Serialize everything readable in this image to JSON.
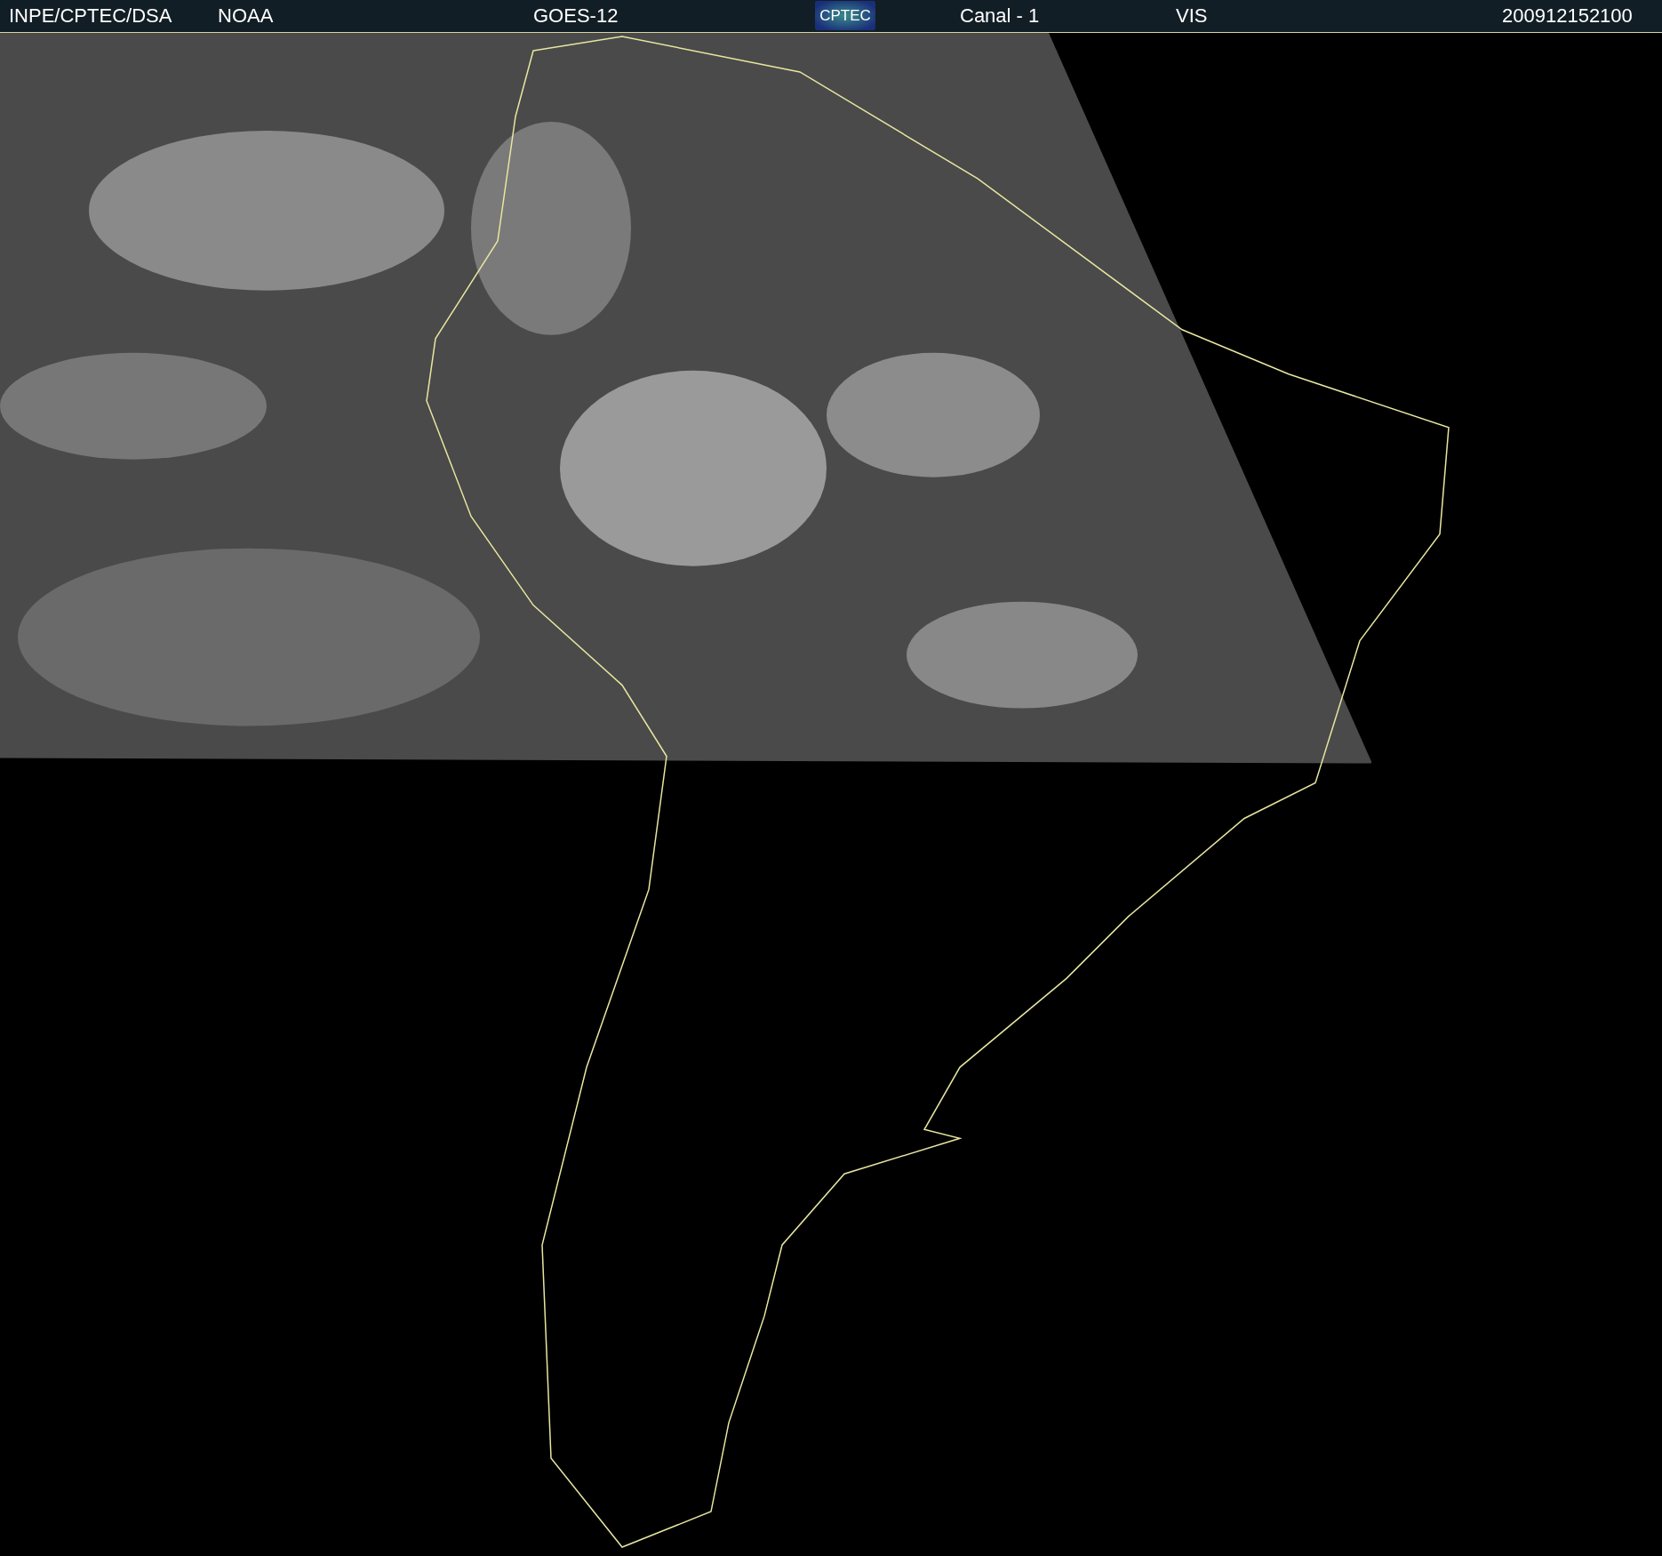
{
  "header": {
    "items": [
      {
        "kind": "text",
        "text": "INPE/CPTEC/DSA"
      },
      {
        "kind": "text",
        "text": "NOAA"
      },
      {
        "kind": "text",
        "text": "GOES-12"
      },
      {
        "kind": "logo",
        "text": "CPTEC"
      },
      {
        "kind": "text",
        "text": "Canal - 1"
      },
      {
        "kind": "text",
        "text": "VIS"
      },
      {
        "kind": "text",
        "text": "200912152100"
      }
    ]
  }
}
